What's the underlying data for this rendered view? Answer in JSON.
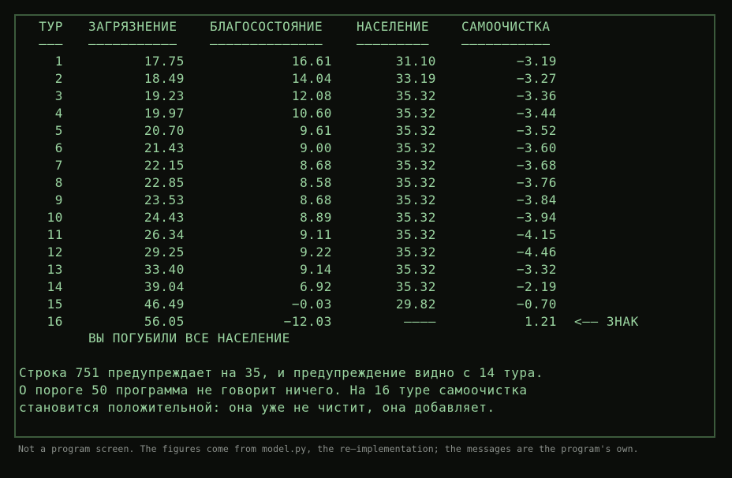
{
  "table": {
    "headers": {
      "tur": "ТУР",
      "pollution": "ЗАГРЯЗНЕНИЕ",
      "welfare": "БЛАГОСОСТОЯНИЕ",
      "population": "НАСЕЛЕНИЕ",
      "self_cleaning": "САМООЧИСТКА"
    },
    "underlines": {
      "tur": "———",
      "pollution": "———————————",
      "welfare": "——————————————",
      "population": "—————————",
      "self_cleaning": "———————————"
    },
    "rows": [
      {
        "tur": "1",
        "pollution": "17.75",
        "welfare": "16.61",
        "population": "31.10",
        "self_cleaning": "−3.19",
        "marker": ""
      },
      {
        "tur": "2",
        "pollution": "18.49",
        "welfare": "14.04",
        "population": "33.19",
        "self_cleaning": "−3.27",
        "marker": ""
      },
      {
        "tur": "3",
        "pollution": "19.23",
        "welfare": "12.08",
        "population": "35.32",
        "self_cleaning": "−3.36",
        "marker": ""
      },
      {
        "tur": "4",
        "pollution": "19.97",
        "welfare": "10.60",
        "population": "35.32",
        "self_cleaning": "−3.44",
        "marker": ""
      },
      {
        "tur": "5",
        "pollution": "20.70",
        "welfare": "9.61",
        "population": "35.32",
        "self_cleaning": "−3.52",
        "marker": ""
      },
      {
        "tur": "6",
        "pollution": "21.43",
        "welfare": "9.00",
        "population": "35.32",
        "self_cleaning": "−3.60",
        "marker": ""
      },
      {
        "tur": "7",
        "pollution": "22.15",
        "welfare": "8.68",
        "population": "35.32",
        "self_cleaning": "−3.68",
        "marker": ""
      },
      {
        "tur": "8",
        "pollution": "22.85",
        "welfare": "8.58",
        "population": "35.32",
        "self_cleaning": "−3.76",
        "marker": ""
      },
      {
        "tur": "9",
        "pollution": "23.53",
        "welfare": "8.68",
        "population": "35.32",
        "self_cleaning": "−3.84",
        "marker": ""
      },
      {
        "tur": "10",
        "pollution": "24.43",
        "welfare": "8.89",
        "population": "35.32",
        "self_cleaning": "−3.94",
        "marker": ""
      },
      {
        "tur": "11",
        "pollution": "26.34",
        "welfare": "9.11",
        "population": "35.32",
        "self_cleaning": "−4.15",
        "marker": ""
      },
      {
        "tur": "12",
        "pollution": "29.25",
        "welfare": "9.22",
        "population": "35.32",
        "self_cleaning": "−4.46",
        "marker": ""
      },
      {
        "tur": "13",
        "pollution": "33.40",
        "welfare": "9.14",
        "population": "35.32",
        "self_cleaning": "−3.32",
        "marker": ""
      },
      {
        "tur": "14",
        "pollution": "39.04",
        "welfare": "6.92",
        "population": "35.32",
        "self_cleaning": "−2.19",
        "marker": ""
      },
      {
        "tur": "15",
        "pollution": "46.49",
        "welfare": "−0.03",
        "population": "29.82",
        "self_cleaning": "−0.70",
        "marker": ""
      },
      {
        "tur": "16",
        "pollution": "56.05",
        "welfare": "−12.03",
        "population": "————",
        "self_cleaning": "1.21",
        "marker": "<—— ЗНАК"
      }
    ]
  },
  "verdict": "ВЫ ПОГУБИЛИ ВСЕ НАСЕЛЕНИЕ",
  "notes": [
    "Строка 751 предупреждает на 35, и предупреждение видно с 14 тура.",
    "О пороге 50 программа не говорит ничего. На 16 туре самоочистка",
    "становится положительной: она уже не чистит, она добавляет."
  ],
  "footer": "Not a program screen. The figures come from model.py, the re–implementation; the messages are the program's own.",
  "colors": {
    "background": "#0b0d0a",
    "terminal_text": "#9ad4a0",
    "border": "#3c5a3c",
    "footer_text": "#8a8f8a"
  }
}
